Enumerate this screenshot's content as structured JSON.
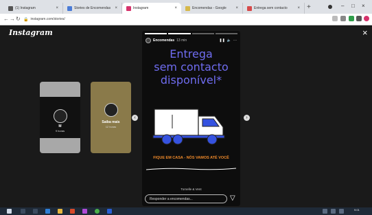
{
  "browser": {
    "tabs": [
      {
        "title": "(1) Instagram",
        "color": "#555555"
      },
      {
        "title": "Stories de Encomendas",
        "color": "#4a7bd6"
      },
      {
        "title": "Instagram",
        "color": "#d6336c"
      },
      {
        "title": "Encomendas - Google",
        "color": "#d6b84a"
      },
      {
        "title": "Entrega sem contacto",
        "color": "#d64a4a"
      }
    ],
    "active_tab_index": 2,
    "new_tab_label": "+",
    "url": "instagram.com/stories/"
  },
  "instagram": {
    "logo": "Instagram",
    "close_label": "×",
    "preview_left": {
      "name": "M",
      "time": "9 horas"
    },
    "preview_right": {
      "name": "Saiba mais",
      "time": "12 horas"
    },
    "story": {
      "username": "Encomendas",
      "time": "13 min",
      "headline_line1": "Entrega",
      "headline_line2": "sem contacto",
      "headline_line3": "disponível*",
      "tagline": "FIQUE EM CASA - NÓS VAMOS ATÉ VOCÊ",
      "sent_by": "Tornelle & Vent",
      "reply_placeholder": "Responder a encomendas...",
      "progress_segments": 4,
      "progress_done": 2,
      "headline_color": "#6f6cf0",
      "tagline_color": "#f08a2a",
      "truck_wheel_color": "#3552e0"
    }
  },
  "taskbar": {
    "time": "9:01"
  }
}
